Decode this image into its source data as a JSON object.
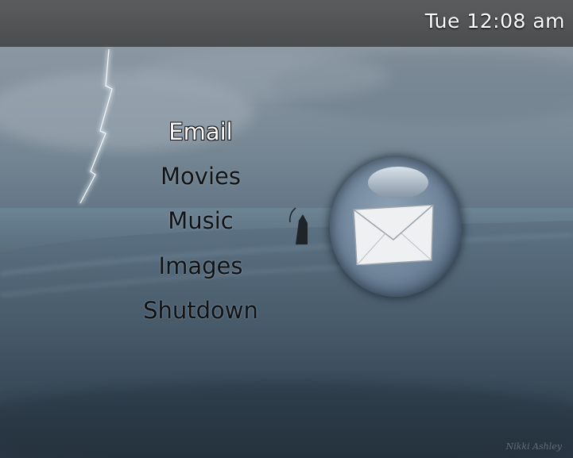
{
  "status_bar": {
    "clock": "Tue 12:08 am"
  },
  "menu": {
    "items": [
      {
        "label": "Email",
        "selected": true
      },
      {
        "label": "Movies",
        "selected": false
      },
      {
        "label": "Music",
        "selected": false
      },
      {
        "label": "Images",
        "selected": false
      },
      {
        "label": "Shutdown",
        "selected": false
      }
    ]
  },
  "preview": {
    "icon": "envelope-icon"
  },
  "wallpaper": {
    "signature": "Nikki Ashley"
  },
  "colors": {
    "topbar": "#4e5052",
    "selected_text": "#fbfbfb",
    "menu_text": "#101214",
    "orb": "#6e8399"
  }
}
